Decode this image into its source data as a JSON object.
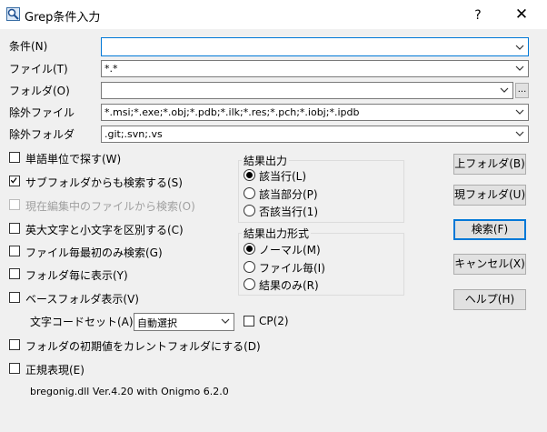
{
  "window": {
    "title": "Grep条件入力",
    "help": "?",
    "close": "✕"
  },
  "fields": {
    "condition": {
      "label": "条件(N)",
      "value": ""
    },
    "file": {
      "label": "ファイル(T)",
      "value": "*.*"
    },
    "folder": {
      "label": "フォルダ(O)",
      "value": "",
      "browse": "..."
    },
    "exclude_file": {
      "label": "除外ファイル",
      "value": "*.msi;*.exe;*.obj;*.pdb;*.ilk;*.res;*.pch;*.iobj;*.ipdb"
    },
    "exclude_folder": {
      "label": "除外フォルダ",
      "value": ".git;.svn;.vs"
    }
  },
  "options": [
    {
      "label": "単語単位で探す(W)",
      "checked": false,
      "disabled": false
    },
    {
      "label": "サブフォルダからも検索する(S)",
      "checked": true,
      "disabled": false
    },
    {
      "label": "現在編集中のファイルから検索(O)",
      "checked": false,
      "disabled": true
    },
    {
      "label": "英大文字と小文字を区別する(C)",
      "checked": false,
      "disabled": false
    },
    {
      "label": "ファイル毎最初のみ検索(G)",
      "checked": false,
      "disabled": false
    },
    {
      "label": "フォルダ毎に表示(Y)",
      "checked": false,
      "disabled": false
    },
    {
      "label": "ベースフォルダ表示(V)",
      "checked": false,
      "disabled": false
    }
  ],
  "encoding": {
    "label": "文字コードセット(A)",
    "value": "自動選択",
    "cp_label": "CP(2)",
    "cp_checked": false
  },
  "option_init_current": {
    "label": "フォルダの初期値をカレントフォルダにする(D)",
    "checked": false
  },
  "option_regex": {
    "label": "正規表現(E)",
    "checked": false
  },
  "version": "bregonig.dll Ver.4.20 with Onigmo 6.2.0",
  "result_output": {
    "title": "結果出力",
    "items": [
      {
        "label": "該当行(L)",
        "selected": true
      },
      {
        "label": "該当部分(P)",
        "selected": false
      },
      {
        "label": "否該当行(1)",
        "selected": false
      }
    ]
  },
  "result_format": {
    "title": "結果出力形式",
    "items": [
      {
        "label": "ノーマル(M)",
        "selected": true
      },
      {
        "label": "ファイル毎(I)",
        "selected": false
      },
      {
        "label": "結果のみ(R)",
        "selected": false
      }
    ]
  },
  "buttons": {
    "parent_folder": "上フォルダ(B)",
    "current_folder": "現フォルダ(U)",
    "search": "検索(F)",
    "cancel": "キャンセル(X)",
    "help": "ヘルプ(H)"
  },
  "colors": {
    "accent": "#0078d7",
    "disabled_text": "#a0a0a0"
  }
}
